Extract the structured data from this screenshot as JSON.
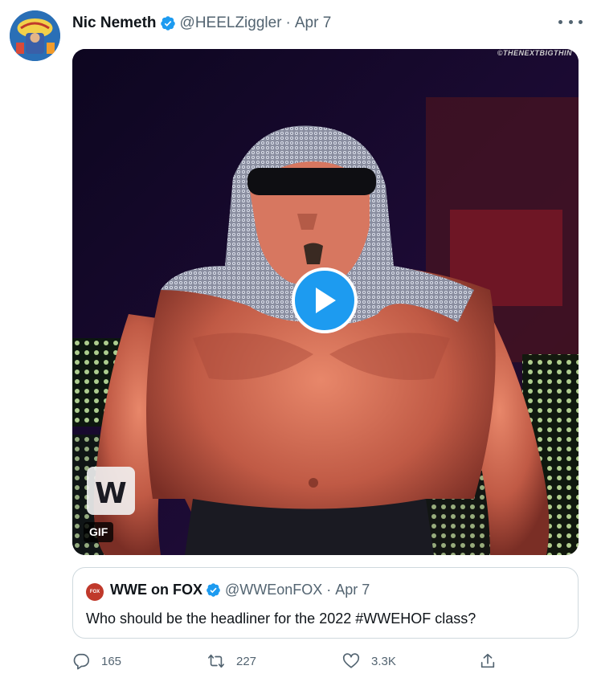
{
  "tweet": {
    "author_name": "Nic Nemeth",
    "handle": "@HEELZiggler",
    "separator": "·",
    "date": "Apr 7",
    "avatar_icon": "avatar-icon",
    "more_icon": "more-options-icon",
    "media": {
      "watermark": "©THENEXTBIGTHIN",
      "badge": "GIF",
      "logo_text": "W",
      "play_color": "#1d9bf0"
    }
  },
  "quote": {
    "author_name": "WWE on FOX",
    "handle": "@WWEonFOX",
    "separator": "·",
    "date": "Apr 7",
    "avatar_text": "FOX",
    "text": "Who should be the headliner for the 2022 #WWEHOF class?"
  },
  "actions": {
    "reply_count": "165",
    "retweet_count": "227",
    "like_count": "3.3K"
  },
  "colors": {
    "verified": "#1d9bf0",
    "secondary_text": "#536471",
    "border": "#cfd9de"
  }
}
